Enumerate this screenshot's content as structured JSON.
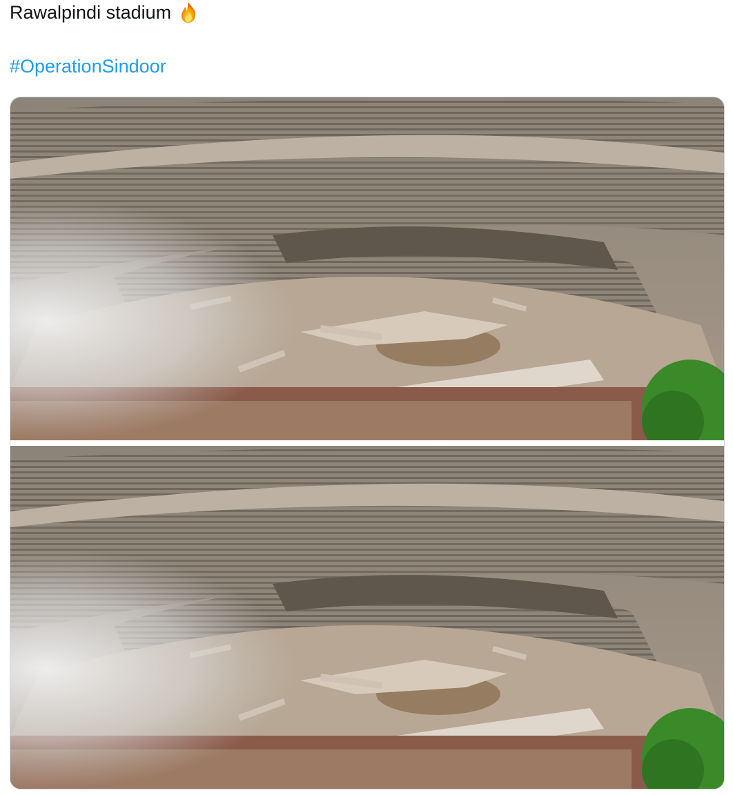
{
  "post": {
    "text_line1": "Rawalpindi stadium",
    "emoji": "fire-icon",
    "hashtag": "#OperationSindoor"
  },
  "media": {
    "images": [
      {
        "alt": "Rawalpindi stadium"
      },
      {
        "alt": "Rawalpindi stadium"
      }
    ]
  },
  "colors": {
    "text": "#0f1419",
    "link": "#1d9bf0",
    "border": "#cfd9de"
  }
}
